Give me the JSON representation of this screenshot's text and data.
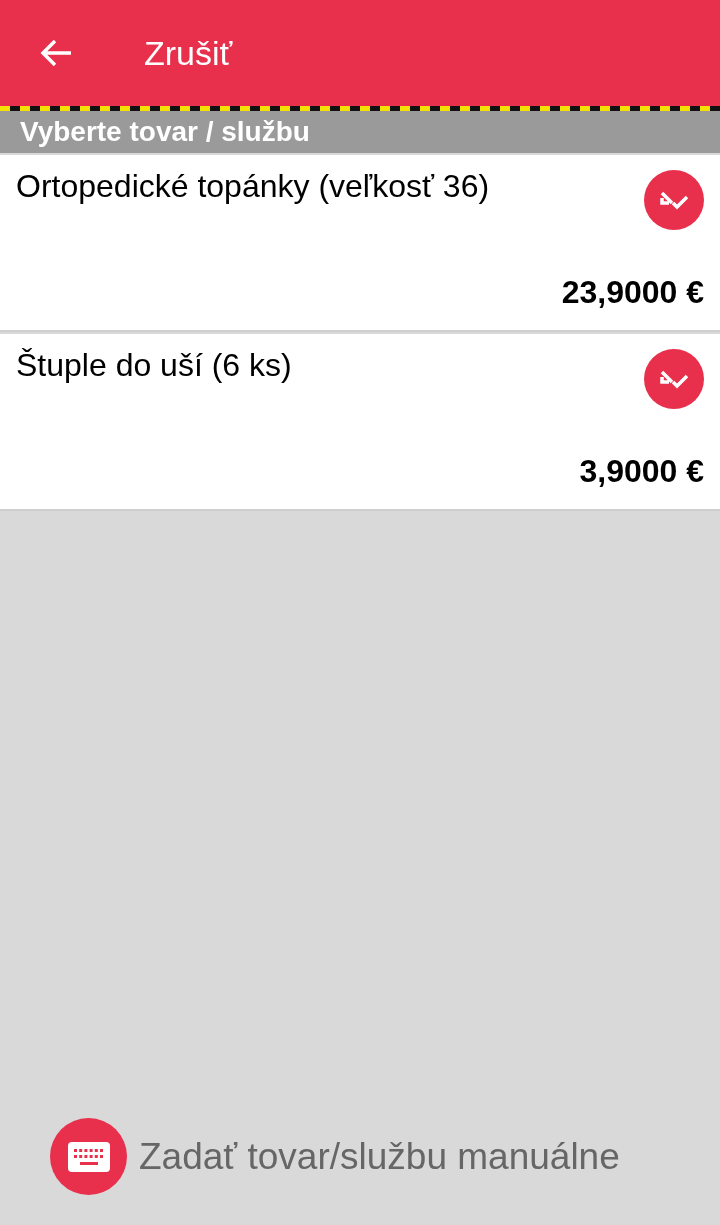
{
  "toolbar": {
    "title": "Zrušiť"
  },
  "section_header": "Vyberte tovar / službu",
  "items": [
    {
      "name": "Ortopedické topánky (veľkosť 36)",
      "price": "23,9000 €"
    },
    {
      "name": "Štuple do uší (6 ks)",
      "price": "3,9000 €"
    }
  ],
  "manual_entry": {
    "label": "Zadať tovar/službu manuálne"
  }
}
